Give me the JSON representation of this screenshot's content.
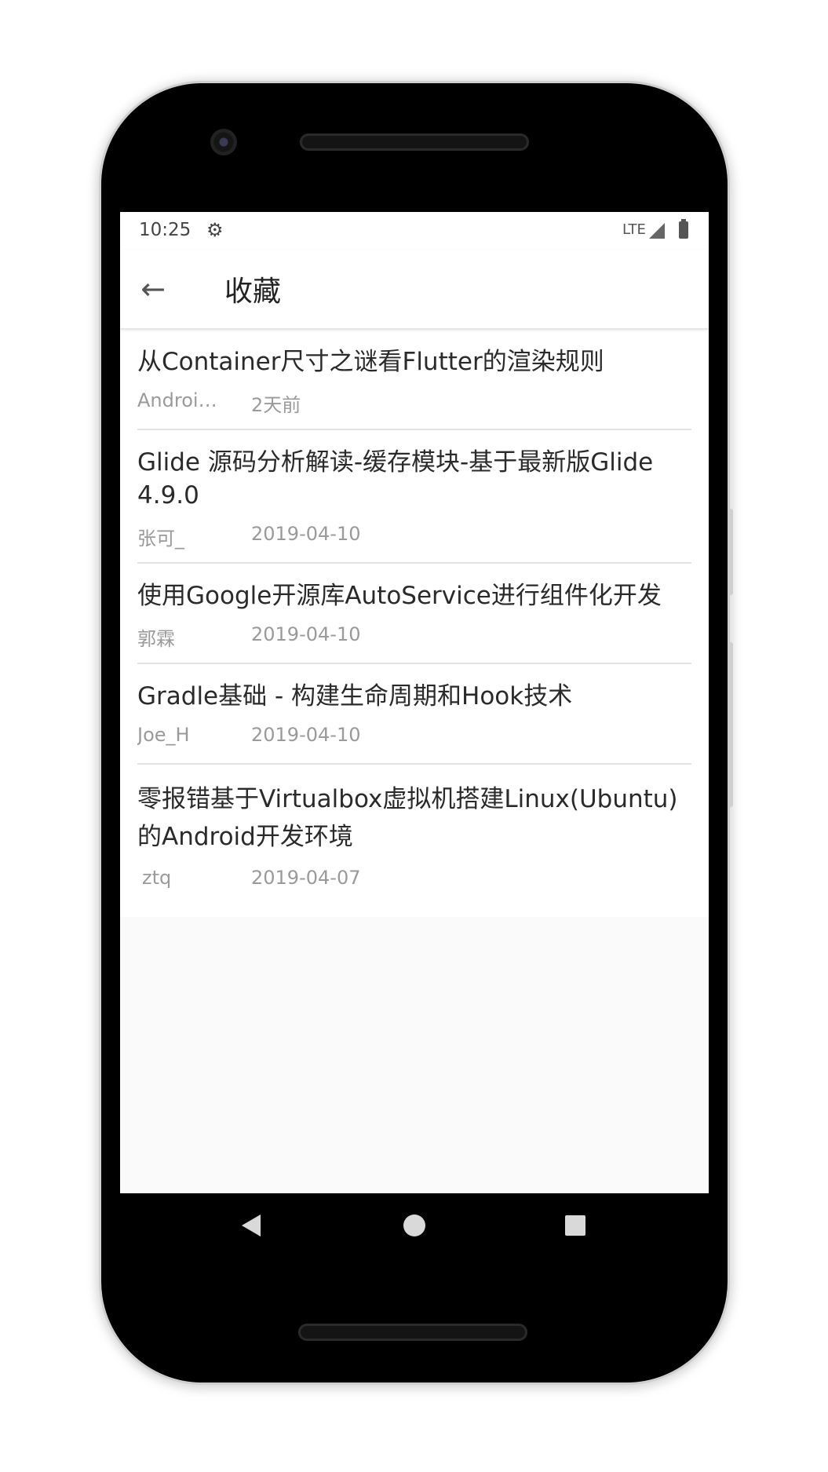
{
  "status_bar": {
    "time": "10:25",
    "network": "LTE",
    "settings_icon": "gear-icon",
    "signal_icon": "signal-icon",
    "battery_icon": "battery-charging-icon"
  },
  "app_bar": {
    "back_icon": "arrow-back-icon",
    "back_glyph": "←",
    "title": "收藏"
  },
  "items": [
    {
      "title": "从Container尺寸之谜看Flutter的渲染规则",
      "author": "Android...",
      "date": "2天前"
    },
    {
      "title": "Glide 源码分析解读-缓存模块-基于最新版Glide 4.9.0",
      "author": "张可_",
      "date": "2019-04-10"
    },
    {
      "title": "使用Google开源库AutoService进行组件化开发",
      "author": "郭霖",
      "date": "2019-04-10"
    },
    {
      "title": "Gradle基础 - 构建生命周期和Hook技术",
      "author": "Joe_H",
      "date": "2019-04-10"
    },
    {
      "title": "零报错基于Virtualbox虚拟机搭建Linux(Ubuntu)的Android开发环境",
      "author": "ztq",
      "date": "2019-04-07"
    }
  ],
  "nav_bar": {
    "back_icon": "nav-back-icon",
    "home_icon": "nav-home-icon",
    "recents_icon": "nav-recents-icon"
  },
  "colors": {
    "app_bar_background": "#ffffff",
    "screen_background": "#fafafa",
    "title_text": "#2a2a2a",
    "meta_text": "#9a9a9a",
    "divider": "#e3e3e3",
    "device_body": "#000000"
  }
}
